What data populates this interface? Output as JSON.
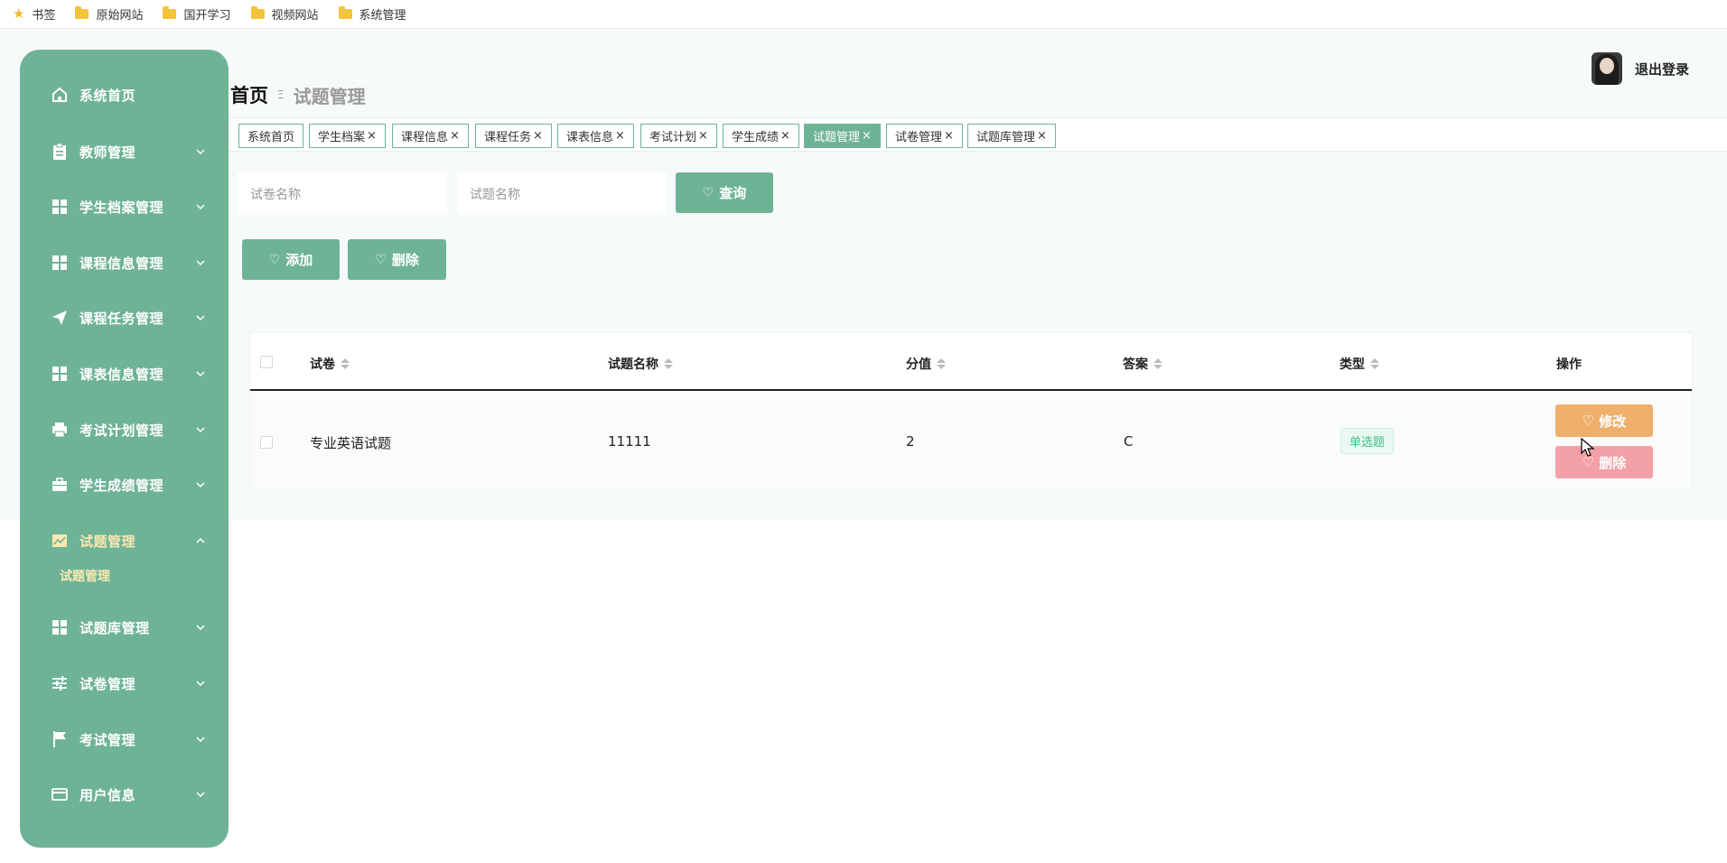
{
  "bookmarks": [
    {
      "label": "书签",
      "icon": "star-icon"
    },
    {
      "label": "原始网站",
      "icon": "folder-icon"
    },
    {
      "label": "国开学习",
      "icon": "folder-icon"
    },
    {
      "label": "视频网站",
      "icon": "folder-icon"
    },
    {
      "label": "系统管理",
      "icon": "folder-icon"
    }
  ],
  "sidebar": {
    "items": [
      {
        "label": "系统首页",
        "icon": "home-icon"
      },
      {
        "label": "教师管理",
        "icon": "clipboard-icon"
      },
      {
        "label": "学生档案管理",
        "icon": "grid-icon"
      },
      {
        "label": "课程信息管理",
        "icon": "grid-icon"
      },
      {
        "label": "课程任务管理",
        "icon": "paper-plane-icon"
      },
      {
        "label": "课表信息管理",
        "icon": "grid-icon"
      },
      {
        "label": "考试计划管理",
        "icon": "printer-icon"
      },
      {
        "label": "学生成绩管理",
        "icon": "briefcase-icon"
      },
      {
        "label": "试题管理",
        "icon": "chart-icon"
      },
      {
        "label": "试题库管理",
        "icon": "grid-icon"
      },
      {
        "label": "试卷管理",
        "icon": "sliders-icon"
      },
      {
        "label": "考试管理",
        "icon": "flag-icon"
      },
      {
        "label": "用户信息",
        "icon": "card-icon"
      }
    ],
    "submenu_label": "试题管理"
  },
  "header": {
    "home": "首页",
    "separator": "Ξ",
    "current": "试题管理",
    "logout": "退出登录"
  },
  "tabs": [
    {
      "label": "系统首页"
    },
    {
      "label": "学生档案",
      "closable": "×"
    },
    {
      "label": "课程信息",
      "closable": "×"
    },
    {
      "label": "课程任务",
      "closable": "×"
    },
    {
      "label": "课表信息",
      "closable": "×"
    },
    {
      "label": "考试计划",
      "closable": "×"
    },
    {
      "label": "学生成绩",
      "closable": "×"
    },
    {
      "label": "试题管理",
      "closable": "×"
    },
    {
      "label": "试卷管理",
      "closable": "×"
    },
    {
      "label": "试题库管理",
      "closable": "×"
    }
  ],
  "search": {
    "paper_placeholder": "试卷名称",
    "question_placeholder": "试题名称",
    "query_label": "查询"
  },
  "actions": {
    "add_label": "添加",
    "delete_label": "删除"
  },
  "table": {
    "headers": [
      "试卷",
      "试题名称",
      "分值",
      "答案",
      "类型",
      "操作"
    ],
    "rows": [
      {
        "paper": "专业英语试题",
        "name": "11111",
        "score": "2",
        "answer": "C",
        "type": "单选题"
      }
    ],
    "edit_label": "修改",
    "delete_label": "删除"
  },
  "colors": {
    "accent": "#6fb397",
    "edit": "#efb06c",
    "delete": "#f3a0a7",
    "active_sub": "#fbe7b0"
  }
}
